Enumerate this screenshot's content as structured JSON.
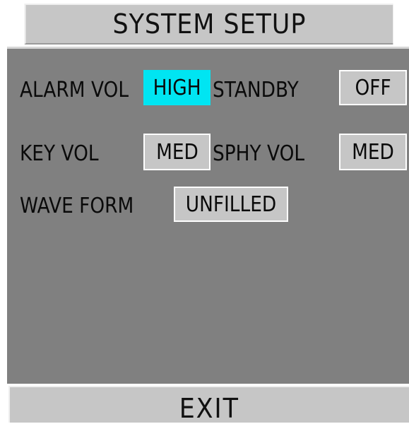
{
  "window": {
    "title": "SYSTEM SETUP"
  },
  "settings": {
    "alarm_vol": {
      "label": "ALARM VOL",
      "value": "HIGH"
    },
    "standby": {
      "label": "STANDBY",
      "value": "OFF"
    },
    "key_vol": {
      "label": "KEY VOL",
      "value": "MED"
    },
    "sphy_vol": {
      "label": "SPHY VOL",
      "value": "MED"
    },
    "wave_form": {
      "label": "WAVE FORM",
      "value": "UNFILLED"
    }
  },
  "footer": {
    "exit_label": "EXIT"
  },
  "colors": {
    "selected": "#00e5f2",
    "panel": "#808080",
    "button": "#c6c6c6"
  }
}
